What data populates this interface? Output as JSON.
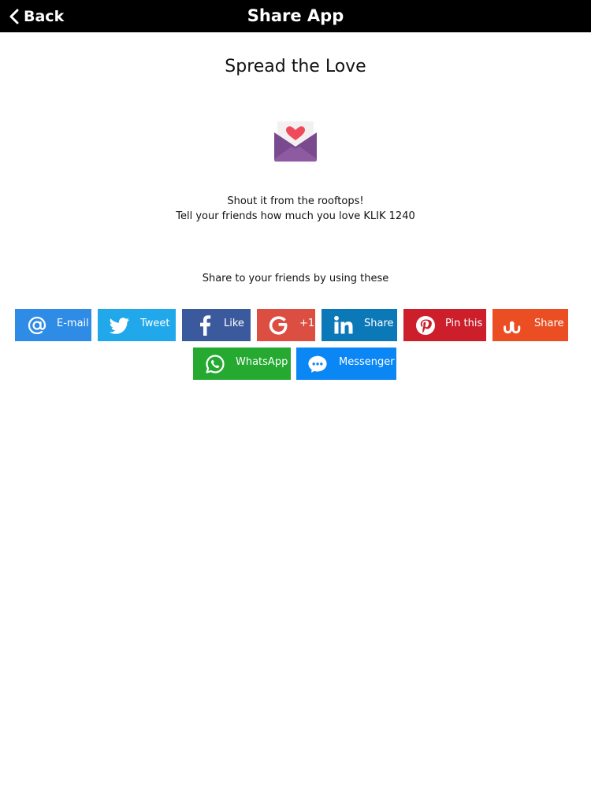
{
  "header": {
    "back_label": "Back",
    "title": "Share App"
  },
  "main": {
    "heading": "Spread the Love",
    "tagline_line1": "Shout it from the rooftops!",
    "tagline_line2": "Tell your friends how much you love KLIK 1240",
    "share_hint": "Share to your friends by using these"
  },
  "share_buttons": [
    {
      "label": "E-mail",
      "icon": "at-icon",
      "color": "#2f8ce6"
    },
    {
      "label": "Tweet",
      "icon": "twitter-icon",
      "color": "#20a8ea"
    },
    {
      "label": "Like",
      "icon": "facebook-icon",
      "color": "#3b5a9e"
    },
    {
      "label": "+1",
      "icon": "google-icon",
      "color": "#dc4e42"
    },
    {
      "label": "Share",
      "icon": "linkedin-icon",
      "color": "#0b78b8"
    },
    {
      "label": "Pin this",
      "icon": "pinterest-icon",
      "color": "#cc1f2b"
    },
    {
      "label": "Share",
      "icon": "stumbleupon-icon",
      "color": "#ec4e23"
    },
    {
      "label": "WhatsApp",
      "icon": "whatsapp-icon",
      "color": "#25a931"
    },
    {
      "label": "Messenger",
      "icon": "messenger-icon",
      "color": "#0a86f5"
    }
  ],
  "colors": {
    "navbar_bg": "#000000",
    "envelope_body": "#7a4a8f",
    "envelope_flap": "#8e5ba3",
    "heart": "#ef4b5a"
  }
}
